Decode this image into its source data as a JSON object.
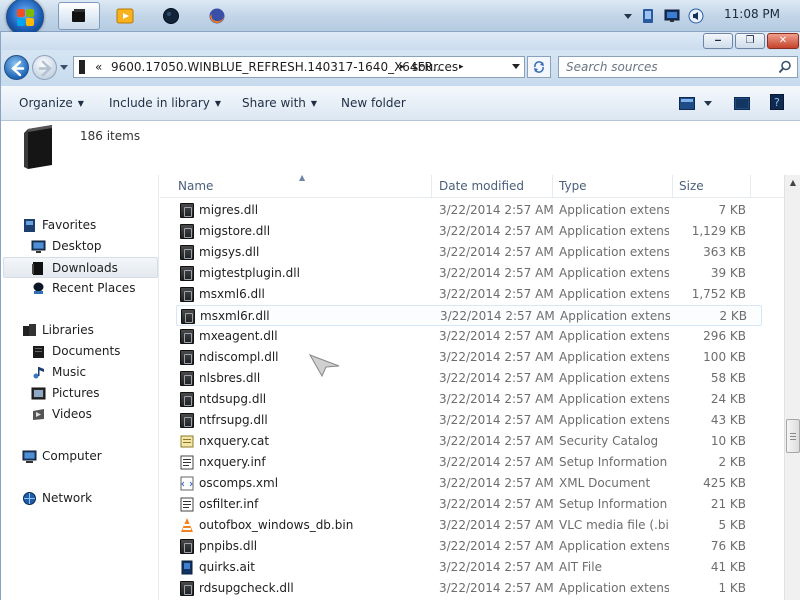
{
  "taskbar": {
    "clock": "11:08 PM",
    "apps": [
      "app-icon-black",
      "media-player-icon",
      "app-icon-dark",
      "firefox-icon"
    ]
  },
  "window": {
    "buttons": {
      "minimize": "‒",
      "maximize": "❐",
      "close": "✕"
    }
  },
  "address": {
    "overflow": "«",
    "crumbs": [
      "9600.17050.WINBLUE_REFRESH.140317-1640_X64FR...",
      "sources"
    ],
    "separator": "▸"
  },
  "search": {
    "placeholder": "Search sources"
  },
  "toolbar": {
    "organize": "Organize",
    "include_in_library": "Include in library",
    "share_with": "Share with",
    "new_folder": "New folder"
  },
  "details": {
    "item_count": "186 items"
  },
  "navpane": {
    "favorites": {
      "label": "Favorites",
      "items": [
        "Desktop",
        "Downloads",
        "Recent Places"
      ]
    },
    "libraries": {
      "label": "Libraries",
      "items": [
        "Documents",
        "Music",
        "Pictures",
        "Videos"
      ]
    },
    "computer": "Computer",
    "network": "Network"
  },
  "columns": {
    "name": "Name",
    "date_modified": "Date modified",
    "type": "Type",
    "size": "Size"
  },
  "files": [
    {
      "name": "migres.dll",
      "date": "3/22/2014 2:57 AM",
      "type": "Application extens...",
      "size": "7 KB",
      "icon": "dll-icon"
    },
    {
      "name": "migstore.dll",
      "date": "3/22/2014 2:57 AM",
      "type": "Application extens...",
      "size": "1,129 KB",
      "icon": "dll-icon"
    },
    {
      "name": "migsys.dll",
      "date": "3/22/2014 2:57 AM",
      "type": "Application extens...",
      "size": "363 KB",
      "icon": "dll-icon"
    },
    {
      "name": "migtestplugin.dll",
      "date": "3/22/2014 2:57 AM",
      "type": "Application extens...",
      "size": "39 KB",
      "icon": "dll-icon"
    },
    {
      "name": "msxml6.dll",
      "date": "3/22/2014 2:57 AM",
      "type": "Application extens...",
      "size": "1,752 KB",
      "icon": "dll-icon"
    },
    {
      "name": "msxml6r.dll",
      "date": "3/22/2014 2:57 AM",
      "type": "Application extens...",
      "size": "2 KB",
      "icon": "dll-icon"
    },
    {
      "name": "mxeagent.dll",
      "date": "3/22/2014 2:57 AM",
      "type": "Application extens...",
      "size": "296 KB",
      "icon": "dll-icon"
    },
    {
      "name": "ndiscompl.dll",
      "date": "3/22/2014 2:57 AM",
      "type": "Application extens...",
      "size": "100 KB",
      "icon": "dll-icon"
    },
    {
      "name": "nlsbres.dll",
      "date": "3/22/2014 2:57 AM",
      "type": "Application extens...",
      "size": "58 KB",
      "icon": "dll-icon"
    },
    {
      "name": "ntdsupg.dll",
      "date": "3/22/2014 2:57 AM",
      "type": "Application extens...",
      "size": "24 KB",
      "icon": "dll-icon"
    },
    {
      "name": "ntfrsupg.dll",
      "date": "3/22/2014 2:57 AM",
      "type": "Application extens...",
      "size": "43 KB",
      "icon": "dll-icon"
    },
    {
      "name": "nxquery.cat",
      "date": "3/22/2014 2:57 AM",
      "type": "Security Catalog",
      "size": "10 KB",
      "icon": "catalog-icon"
    },
    {
      "name": "nxquery.inf",
      "date": "3/22/2014 2:57 AM",
      "type": "Setup Information",
      "size": "2 KB",
      "icon": "inf-icon"
    },
    {
      "name": "oscomps.xml",
      "date": "3/22/2014 2:57 AM",
      "type": "XML Document",
      "size": "425 KB",
      "icon": "xml-icon"
    },
    {
      "name": "osfilter.inf",
      "date": "3/22/2014 2:57 AM",
      "type": "Setup Information",
      "size": "21 KB",
      "icon": "inf-icon"
    },
    {
      "name": "outofbox_windows_db.bin",
      "date": "3/22/2014 2:57 AM",
      "type": "VLC media file (.bi...",
      "size": "5 KB",
      "icon": "vlc-icon"
    },
    {
      "name": "pnpibs.dll",
      "date": "3/22/2014 2:57 AM",
      "type": "Application extens...",
      "size": "76 KB",
      "icon": "dll-icon"
    },
    {
      "name": "quirks.ait",
      "date": "3/22/2014 2:57 AM",
      "type": "AIT File",
      "size": "41 KB",
      "icon": "ait-icon"
    },
    {
      "name": "rdsupgcheck.dll",
      "date": "3/22/2014 2:57 AM",
      "type": "Application extens...",
      "size": "1 KB",
      "icon": "dll-icon"
    }
  ],
  "hover_row": 5
}
